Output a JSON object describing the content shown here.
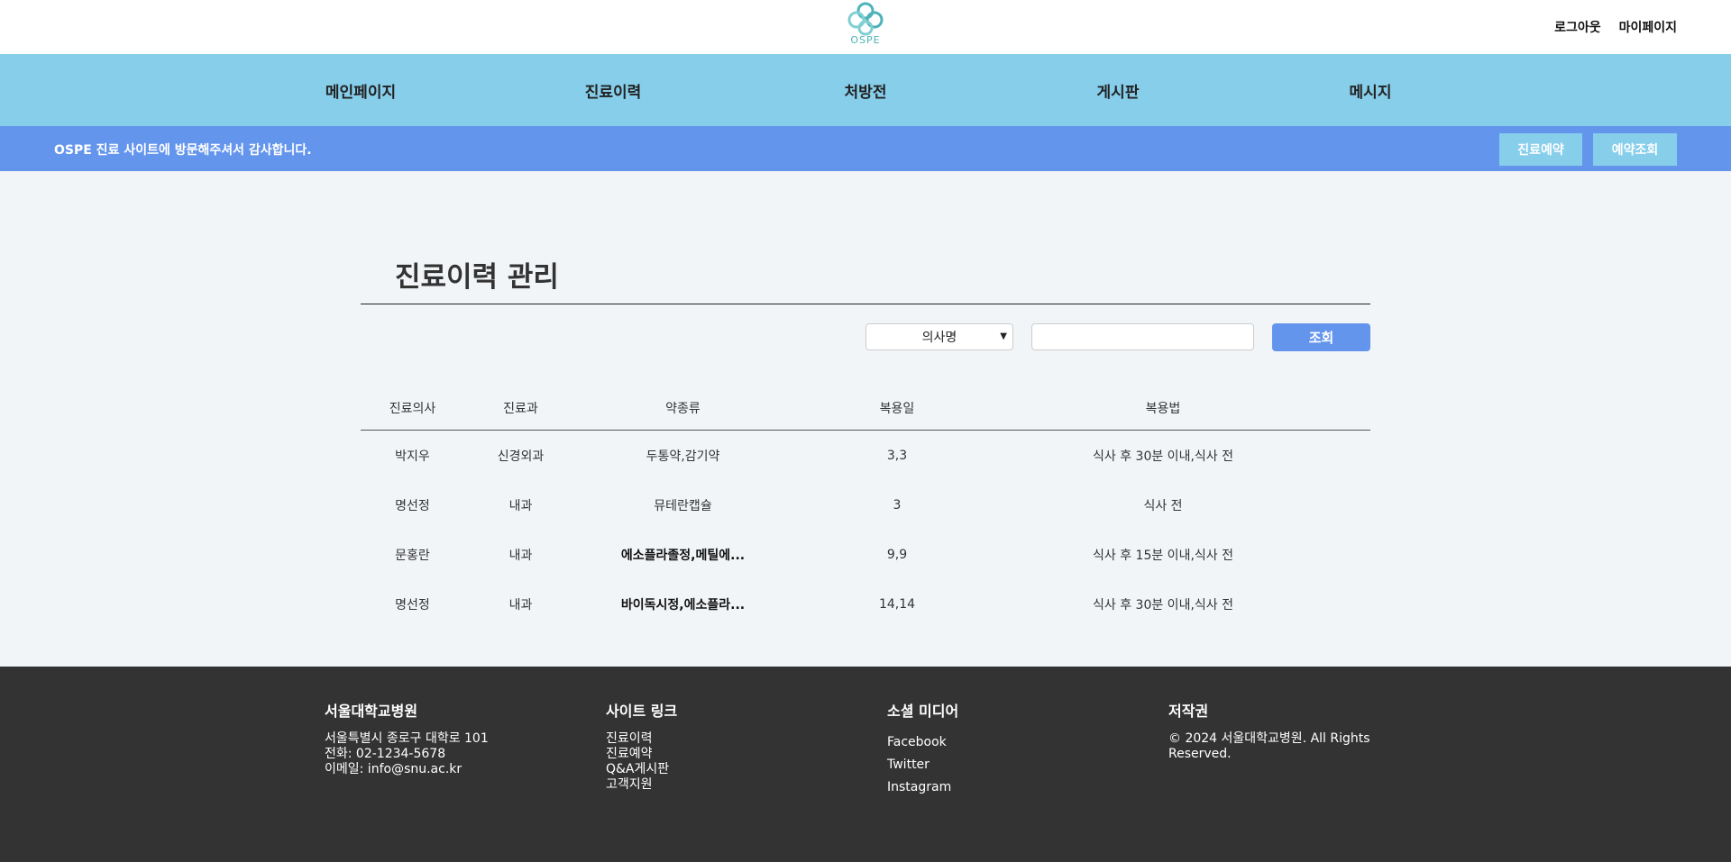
{
  "header": {
    "logo_text": "OSPE",
    "logout_label": "로그아웃",
    "mypage_label": "마이페이지"
  },
  "nav": {
    "items": [
      "메인페이지",
      "진료이력",
      "처방전",
      "게시판",
      "메시지"
    ]
  },
  "notice": {
    "text": "OSPE 진료 사이트에 방문해주셔서 감사합니다.",
    "reserve_label": "진료예약",
    "lookup_label": "예약조회"
  },
  "main": {
    "title": "진료이력 관리",
    "search": {
      "select_value": "의사명",
      "input_value": "",
      "button_label": "조회"
    },
    "table": {
      "headers": [
        "진료의사",
        "진료과",
        "약종류",
        "복용일",
        "복용법"
      ],
      "rows": [
        [
          "박지우",
          "신경외과",
          "두통약,감기약",
          "3,3",
          "식사 후 30분 이내,식사 전"
        ],
        [
          "명선정",
          "내과",
          "뮤테란캡슐",
          "3",
          "식사 전"
        ],
        [
          "문홍란",
          "내과",
          "에소플라졸정,메틸에...",
          "9,9",
          "식사 후 15분 이내,식사 전"
        ],
        [
          "명선정",
          "내과",
          "바이독시정,에소플라...",
          "14,14",
          "식사 후 30분 이내,식사 전"
        ]
      ]
    }
  },
  "footer": {
    "hospital": {
      "title": "서울대학교병원",
      "address": "서울특별시 종로구 대학로 101",
      "phone": "전화: 02-1234-5678",
      "email": "이메일: info@snu.ac.kr"
    },
    "links": {
      "title": "사이트 링크",
      "items": [
        "진료이력",
        "진료예약",
        "Q&A게시판",
        "고객지원"
      ]
    },
    "social": {
      "title": "소셜 미디어",
      "items": [
        "Facebook",
        "Twitter",
        "Instagram"
      ]
    },
    "copyright": {
      "title": "저작권",
      "text": "© 2024 서울대학교병원. All Rights Reserved."
    }
  },
  "colors": {
    "nav_bg": "#87ceeb",
    "notice_bg": "#6495ed",
    "footer_bg": "#333333",
    "content_bg": "#f2f5f8"
  }
}
